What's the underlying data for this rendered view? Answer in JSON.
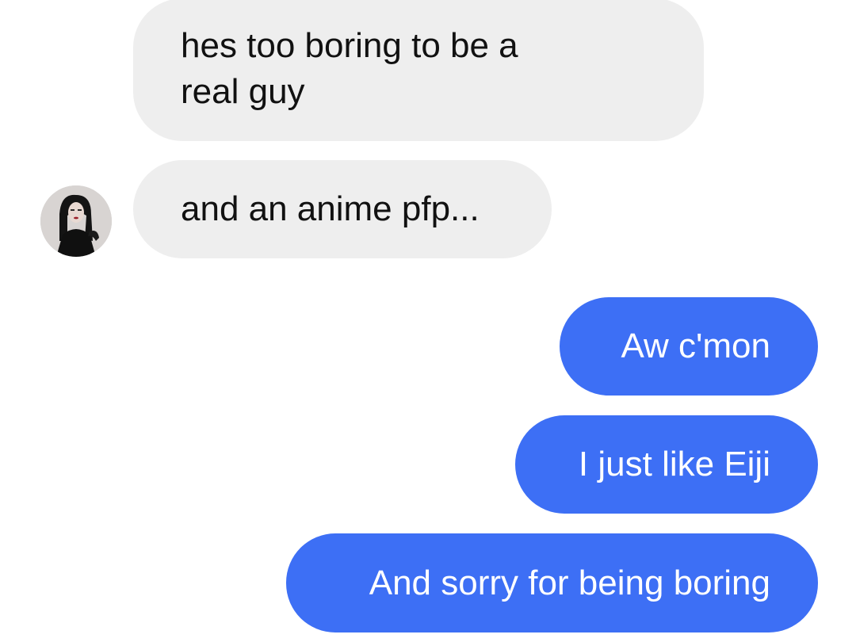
{
  "conversation": {
    "messages": [
      {
        "sender": "them",
        "text": "hes too boring to be a\nreal guy"
      },
      {
        "sender": "them",
        "text": "and an anime pfp..."
      },
      {
        "sender": "me",
        "text": "Aw c'mon"
      },
      {
        "sender": "me",
        "text": "I just like Eiji"
      },
      {
        "sender": "me",
        "text": "And sorry for being boring"
      }
    ]
  },
  "colors": {
    "incoming_bubble": "#eeeeee",
    "outgoing_bubble": "#3d6ff5",
    "incoming_text": "#111111",
    "outgoing_text": "#ffffff"
  },
  "avatar": {
    "icon": "contact-avatar-icon"
  }
}
